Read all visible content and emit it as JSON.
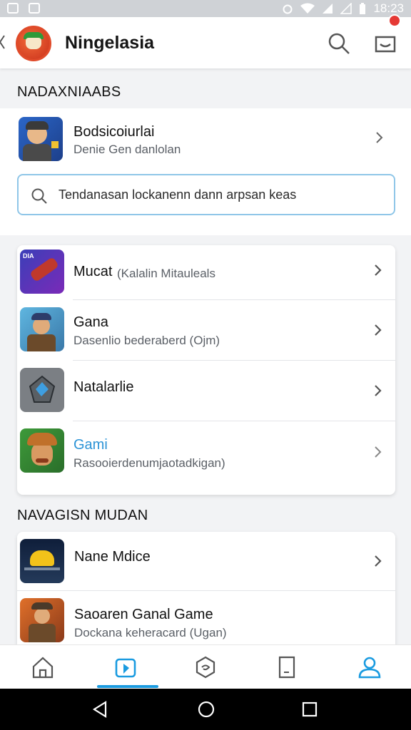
{
  "status_bar": {
    "time": "18:23"
  },
  "app_bar": {
    "title": "Ningelasia"
  },
  "section1": {
    "title": "NADAXNIAABS"
  },
  "featured": {
    "title": "Bodsicoiurlai",
    "subtitle": "Denie Gen danlolan"
  },
  "search": {
    "placeholder": "Tendanasan lockanenn dann arpsan keas"
  },
  "list1": [
    {
      "title": "Mucat",
      "inline_sub": "(Kalalin Mitauleals",
      "subtitle": ""
    },
    {
      "title": "Gana",
      "inline_sub": "",
      "subtitle": "Dasenlio bederaberd (Ojm)"
    },
    {
      "title": "Natalarlie",
      "inline_sub": "",
      "subtitle": ""
    },
    {
      "title": "Gami",
      "inline_sub": "",
      "subtitle": "Rasooierdenumjaotadkigan)"
    }
  ],
  "section2": {
    "title": "NAVAGISN MUDAN"
  },
  "list2": [
    {
      "title": "Nane Mdice",
      "subtitle": ""
    },
    {
      "title": "Saoaren Ganal Game",
      "subtitle": "Dockana keheracard (Ugan)"
    }
  ],
  "colors": {
    "accent": "#1a9be0",
    "highlight_title": "#2b93d6"
  },
  "icons": [
    "search-icon",
    "notification-icon",
    "home-icon",
    "store-icon",
    "game-controller-icon",
    "book-icon",
    "profile-icon"
  ]
}
